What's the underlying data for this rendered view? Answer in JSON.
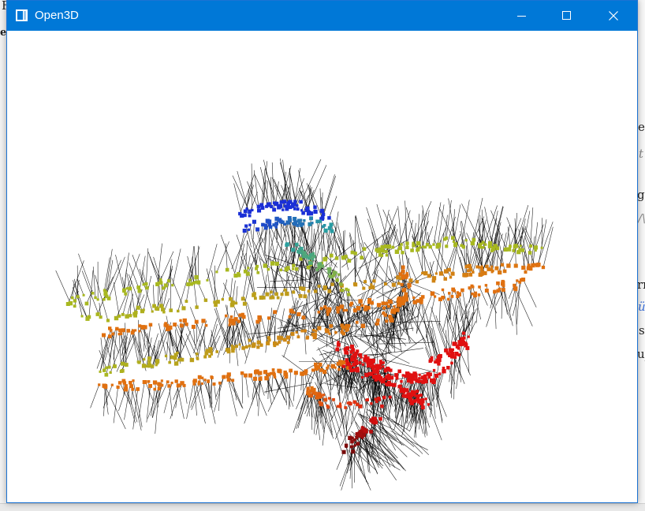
{
  "window": {
    "title": "Open3D",
    "icon": "open3d-window-icon",
    "controls": [
      "minimize-icon",
      "maximize-icon",
      "close-icon"
    ],
    "titlebar_color": "#0078d7"
  },
  "background_app": {
    "fragments": [
      "F",
      "e",
      "e",
      "e",
      "t",
      "ge",
      "/\\",
      "rn",
      "ü",
      "s",
      "u_"
    ]
  },
  "viewport": {
    "background": "#ffffff",
    "content": "point-cloud-with-normals",
    "colors": {
      "blue": "#1a2fd6",
      "cyan": "#2aa0a0",
      "yellow_green": "#a8b820",
      "orange": "#e07010",
      "red": "#e01010",
      "dark_red": "#6b0a0a",
      "normal_lines": "#000000"
    }
  }
}
